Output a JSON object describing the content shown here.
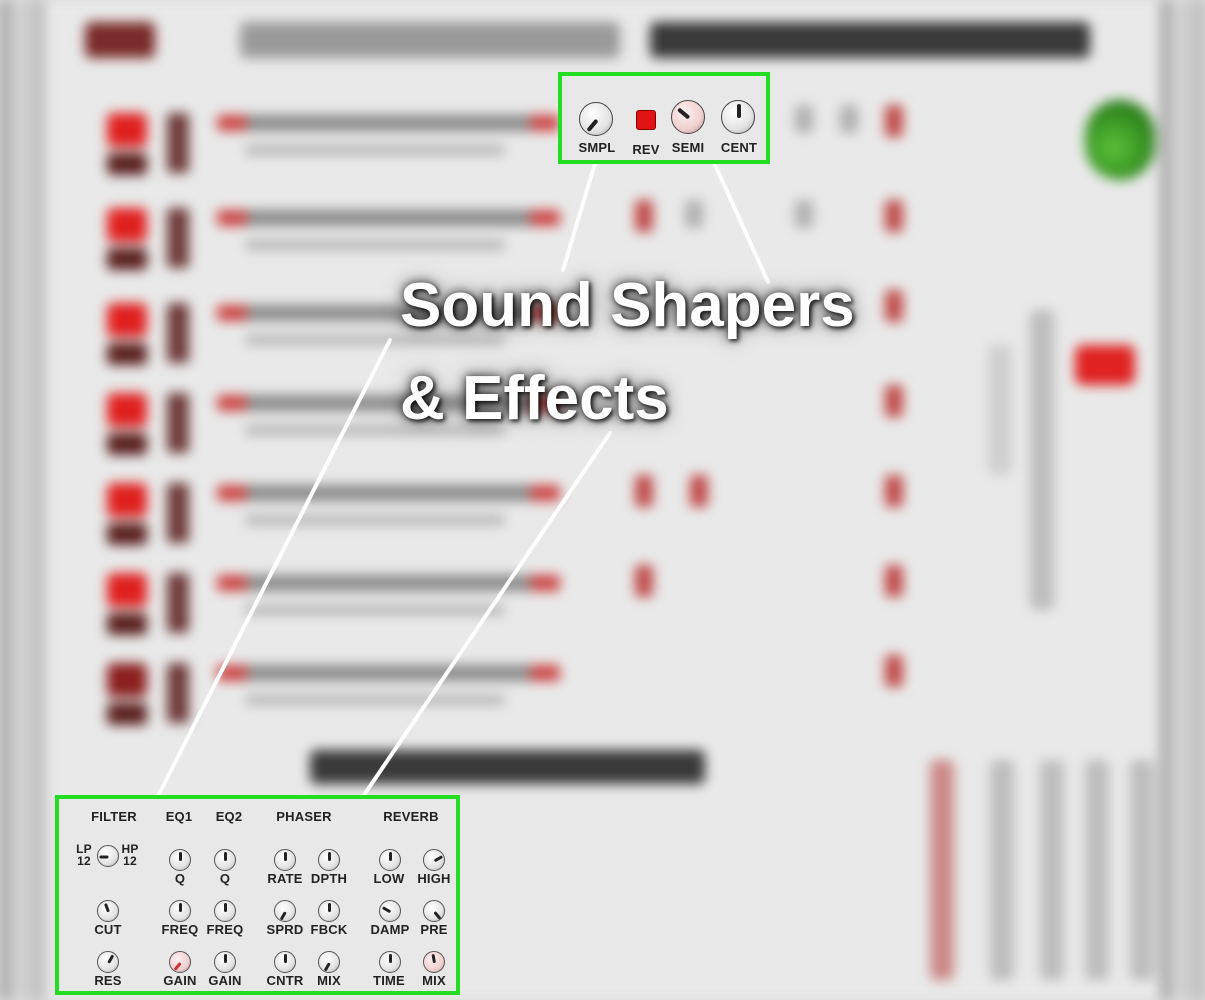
{
  "overlay": {
    "title_line1": "Sound Shapers",
    "title_line2": "& Effects"
  },
  "top_panel": {
    "controls": [
      {
        "label": "SMPL",
        "type": "knob"
      },
      {
        "label": "REV",
        "type": "button"
      },
      {
        "label": "SEMI",
        "type": "knob"
      },
      {
        "label": "CENT",
        "type": "knob"
      }
    ]
  },
  "bottom_panel": {
    "headers": [
      "FILTER",
      "EQ1",
      "EQ2",
      "PHASER",
      "REVERB"
    ],
    "filter_switch": {
      "left": "LP",
      "left_sub": "12",
      "right": "HP",
      "right_sub": "12"
    },
    "rows": [
      [
        "Q",
        "Q",
        "RATE",
        "DPTH",
        "LOW",
        "HIGH"
      ],
      [
        "CUT",
        "FREQ",
        "FREQ",
        "SPRD",
        "FBCK",
        "DAMP",
        "PRE"
      ],
      [
        "RES",
        "GAIN",
        "GAIN",
        "CNTR",
        "MIX",
        "TIME",
        "MIX"
      ]
    ]
  },
  "colors": {
    "callout_border": "#22dd22",
    "accent_red": "#e01414"
  }
}
